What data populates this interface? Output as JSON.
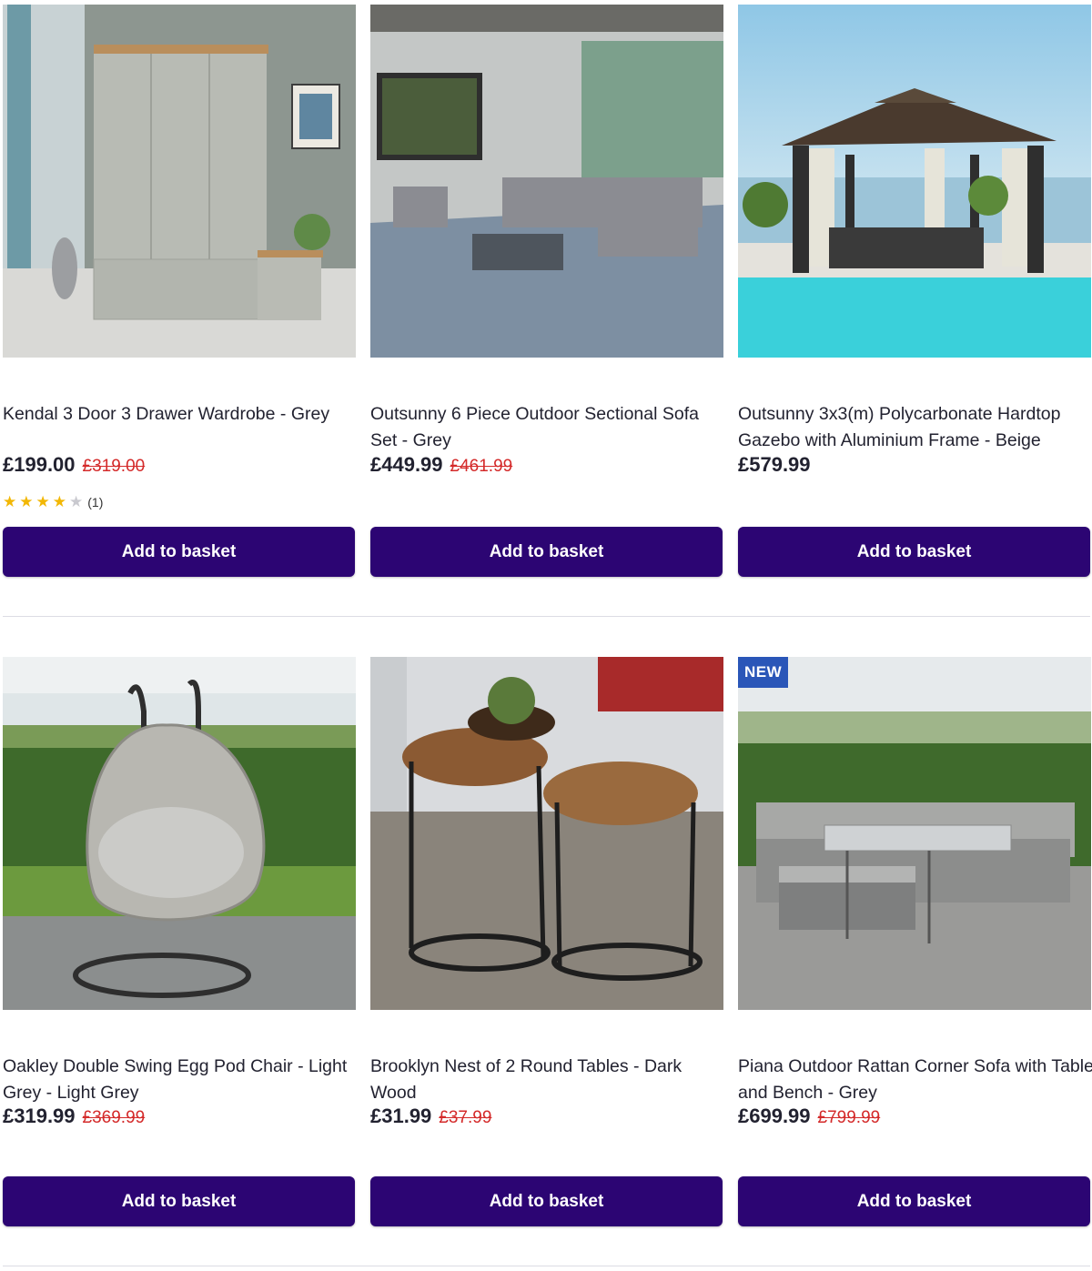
{
  "products": [
    {
      "title": "Kendal 3 Door 3 Drawer Wardrobe - Grey",
      "price": "£199.00",
      "was": "£319.00",
      "rating_count": "(1)",
      "rating": 4,
      "button": "Add to basket",
      "image": "wardrobe-photo"
    },
    {
      "title": "Outsunny 6 Piece Outdoor Sectional Sofa Set - Grey",
      "price": "£449.99",
      "was": "£461.99",
      "button": "Add to basket",
      "image": "outdoor-sofa-photo"
    },
    {
      "title": "Outsunny 3x3(m) Polycarbonate Hardtop Gazebo with Aluminium Frame - Beige",
      "price": "£579.99",
      "button": "Add to basket",
      "image": "gazebo-photo"
    },
    {
      "title": "Oakley Double Swing Egg Pod Chair - Light Grey - Light Grey",
      "price": "£319.99",
      "was": "£369.99",
      "button": "Add to basket",
      "image": "egg-chair-photo"
    },
    {
      "title": "Brooklyn Nest of 2 Round Tables - Dark Wood",
      "price": "£31.99",
      "was": "£37.99",
      "button": "Add to basket",
      "image": "nest-tables-photo"
    },
    {
      "title": "Piana Outdoor Rattan Corner Sofa with Table and Bench - Grey",
      "price": "£699.99",
      "was": "£799.99",
      "badge": "NEW",
      "button": "Add to basket",
      "image": "rattan-sofa-photo"
    }
  ],
  "colors": {
    "button": "#2c0573",
    "was_price": "#d42a2a",
    "badge": "#2a56b8",
    "star": "#f2b705"
  }
}
